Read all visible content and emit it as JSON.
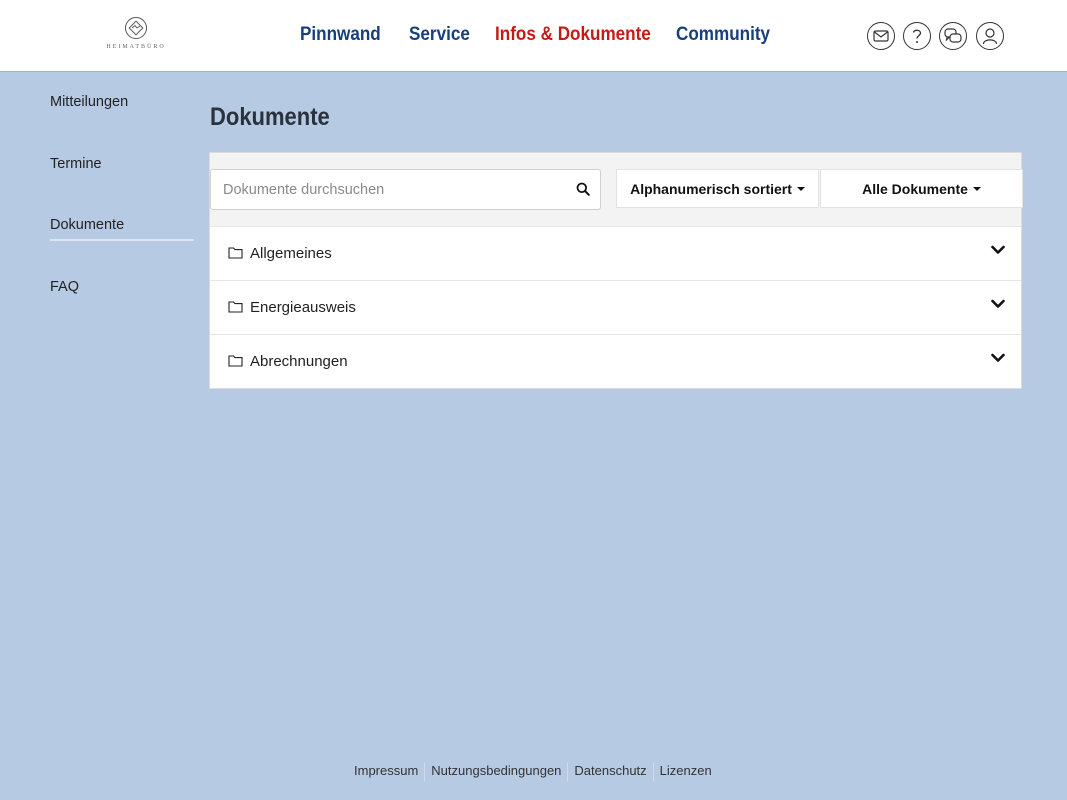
{
  "brand": {
    "logo_text": "HEIMATBÜRO"
  },
  "nav": {
    "items": [
      {
        "label": "Pinnwand"
      },
      {
        "label": "Service"
      },
      {
        "label": "Infos & Dokumente"
      },
      {
        "label": "Community"
      }
    ],
    "active_index": 2
  },
  "header_icons": [
    "mail-icon",
    "help-icon",
    "chat-icon",
    "user-icon"
  ],
  "sidebar": {
    "items": [
      {
        "label": "Mitteilungen"
      },
      {
        "label": "Termine"
      },
      {
        "label": "Dokumente"
      },
      {
        "label": "FAQ"
      }
    ],
    "active_index": 2
  },
  "main": {
    "title": "Dokumente",
    "search": {
      "placeholder": "Dokumente durchsuchen",
      "value": ""
    },
    "sort_label": "Alphanumerisch sortiert",
    "filter_label": "Alle Dokumente",
    "folders": [
      {
        "label": "Allgemeines"
      },
      {
        "label": "Energieausweis"
      },
      {
        "label": "Abrechnungen"
      }
    ]
  },
  "footer": {
    "links": [
      {
        "label": "Impressum"
      },
      {
        "label": "Nutzungsbedingungen"
      },
      {
        "label": "Datenschutz"
      },
      {
        "label": "Lizenzen"
      }
    ]
  },
  "colors": {
    "background": "#b7cae4",
    "nav_text": "#173f7c",
    "nav_active": "#c61a15"
  }
}
